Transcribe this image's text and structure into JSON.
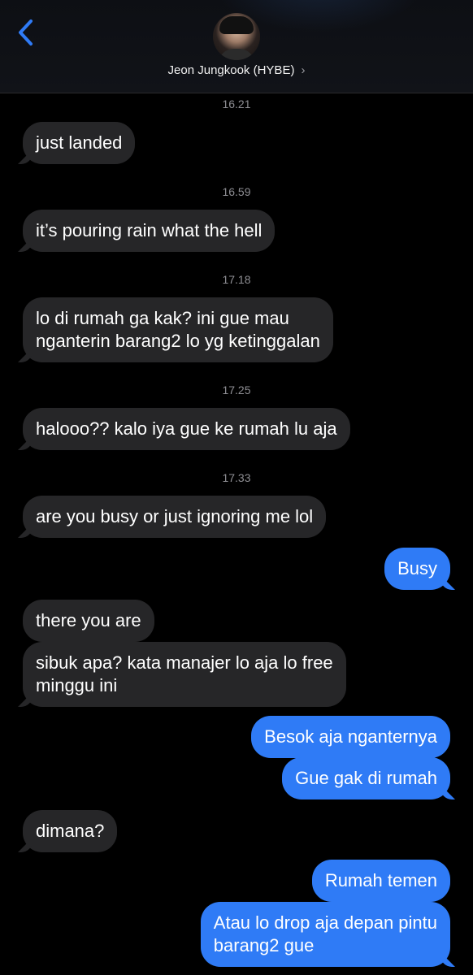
{
  "header": {
    "contact_name": "Jeon Jungkook (HYBE)",
    "chevron": "›"
  },
  "timestamps": [
    "16.21",
    "16.59",
    "17.18",
    "17.25",
    "17.33"
  ],
  "messages": [
    {
      "from": "them",
      "text": "just landed"
    },
    {
      "from": "them",
      "text": "it’s pouring rain what the hell"
    },
    {
      "from": "them",
      "line1": "lo di rumah ga kak? ini gue mau",
      "line2": "nganterin barang2 lo yg ketinggalan"
    },
    {
      "from": "them",
      "text": "halooo?? kalo iya gue ke rumah lu aja"
    },
    {
      "from": "them",
      "text": "are you busy or just ignoring me lol"
    },
    {
      "from": "me",
      "text": "Busy"
    },
    {
      "from": "them",
      "text": "there you are"
    },
    {
      "from": "them",
      "line1": "sibuk apa? kata manajer lo aja lo free",
      "line2": "minggu ini"
    },
    {
      "from": "me",
      "text": "Besok aja nganternya"
    },
    {
      "from": "me",
      "text": "Gue gak di rumah"
    },
    {
      "from": "them",
      "text": "dimana?"
    },
    {
      "from": "me",
      "text": "Rumah temen"
    },
    {
      "from": "me",
      "line1": "Atau lo drop aja depan pintu",
      "line2": "barang2 gue"
    }
  ],
  "icons": {
    "back": "chevron-left-icon",
    "avatar": "contact-avatar"
  },
  "colors": {
    "incoming_bubble": "#262628",
    "outgoing_bubble": "#2f7bf6",
    "back_accent": "#2f7bf6",
    "timestamp": "#8e8e93"
  }
}
